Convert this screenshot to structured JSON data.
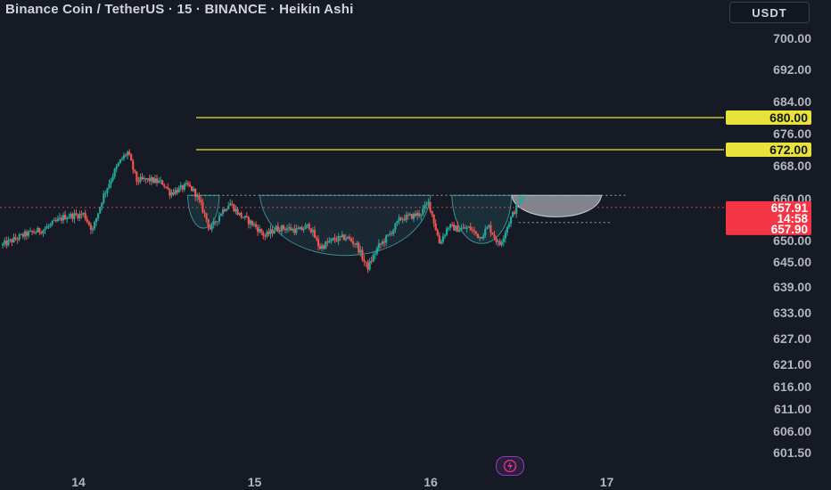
{
  "header": {
    "title": "Binance Coin / TetherUS · 15 · BINANCE · Heikin Ashi",
    "currency": "USDT"
  },
  "colors": {
    "background": "#161a25",
    "up": "#26a69a",
    "down": "#ef5350",
    "level_line": "#e8e23a",
    "pattern_fill": "#2b6f73",
    "projection_fill": "#c8ccd4",
    "price_label_bg": "#f23645"
  },
  "chart_data": {
    "type": "candlestick",
    "chart_style": "Heikin Ashi",
    "symbol": "BNBUSDT",
    "interval": "15",
    "exchange": "BINANCE",
    "y_ticks": [
      {
        "label": "700.00",
        "value": 700.0
      },
      {
        "label": "692.00",
        "value": 692.0
      },
      {
        "label": "684.00",
        "value": 684.0
      },
      {
        "label": "676.00",
        "value": 676.0
      },
      {
        "label": "668.00",
        "value": 668.0
      },
      {
        "label": "660.00",
        "value": 660.0
      },
      {
        "label": "650.00",
        "value": 650.0
      },
      {
        "label": "645.00",
        "value": 645.0
      },
      {
        "label": "639.00",
        "value": 639.0
      },
      {
        "label": "633.00",
        "value": 633.0
      },
      {
        "label": "627.00",
        "value": 627.0
      },
      {
        "label": "621.00",
        "value": 621.0
      },
      {
        "label": "616.00",
        "value": 616.0
      },
      {
        "label": "611.00",
        "value": 611.0
      },
      {
        "label": "606.00",
        "value": 606.0
      },
      {
        "label": "601.50",
        "value": 601.5
      }
    ],
    "x_ticks": [
      {
        "label": "14",
        "t": 0.0
      },
      {
        "label": "15",
        "t": 1.0
      },
      {
        "label": "16",
        "t": 2.0
      },
      {
        "label": "17",
        "t": 3.0
      }
    ],
    "t_range": [
      -0.44,
      3.3
    ],
    "levels": [
      {
        "label": "680.00",
        "value": 680.0
      },
      {
        "label": "672.00",
        "value": 672.0
      }
    ],
    "current_price": {
      "price": "657.91",
      "countdown": "14:58",
      "value": 657.91
    },
    "last_close_label": {
      "price": "657.90",
      "value": 657.9
    },
    "neckline": {
      "value": 660.8,
      "t_start": 0.64,
      "t_end": 3.11
    },
    "projection_target": {
      "value": 654.3,
      "t_start": 2.5,
      "t_end": 3.02
    },
    "pattern": {
      "name": "inverse head and shoulders",
      "left_shoulder": {
        "t_start": 0.62,
        "t_end": 0.8,
        "low": 651.2
      },
      "head": {
        "t_start": 1.03,
        "t_end": 2.0,
        "low": 642.6
      },
      "right_shoulder": {
        "t_start": 2.12,
        "t_end": 2.46,
        "low": 646.4
      },
      "projection": {
        "t_start": 2.46,
        "t_end": 2.97,
        "low": 654.8
      }
    },
    "price_path": [
      [
        -0.44,
        648.8
      ],
      [
        -0.3,
        651.5
      ],
      [
        -0.2,
        652.6
      ],
      [
        -0.08,
        655.7
      ],
      [
        0.03,
        656.3
      ],
      [
        0.08,
        652.4
      ],
      [
        0.14,
        660.6
      ],
      [
        0.2,
        666.2
      ],
      [
        0.24,
        669.4
      ],
      [
        0.28,
        671.4
      ],
      [
        0.33,
        664.4
      ],
      [
        0.4,
        664.6
      ],
      [
        0.48,
        663.8
      ],
      [
        0.52,
        661.4
      ],
      [
        0.58,
        662.4
      ],
      [
        0.62,
        663.2
      ],
      [
        0.66,
        661.6
      ],
      [
        0.71,
        657.0
      ],
      [
        0.75,
        652.5
      ],
      [
        0.81,
        656.8
      ],
      [
        0.86,
        659.0
      ],
      [
        0.91,
        656.3
      ],
      [
        1.0,
        653.6
      ],
      [
        1.06,
        651.0
      ],
      [
        1.12,
        652.9
      ],
      [
        1.18,
        653.0
      ],
      [
        1.25,
        652.3
      ],
      [
        1.31,
        653.6
      ],
      [
        1.37,
        648.3
      ],
      [
        1.44,
        650.1
      ],
      [
        1.52,
        650.8
      ],
      [
        1.58,
        649.0
      ],
      [
        1.64,
        643.5
      ],
      [
        1.7,
        648.4
      ],
      [
        1.76,
        651.1
      ],
      [
        1.83,
        655.3
      ],
      [
        1.89,
        655.8
      ],
      [
        1.94,
        656.4
      ],
      [
        1.99,
        659.1
      ],
      [
        2.05,
        649.4
      ],
      [
        2.1,
        653.4
      ],
      [
        2.16,
        652.7
      ],
      [
        2.22,
        653.0
      ],
      [
        2.28,
        650.8
      ],
      [
        2.33,
        653.4
      ],
      [
        2.39,
        648.8
      ],
      [
        2.45,
        654.9
      ],
      [
        2.5,
        659.1
      ],
      [
        2.53,
        660.4
      ]
    ]
  }
}
